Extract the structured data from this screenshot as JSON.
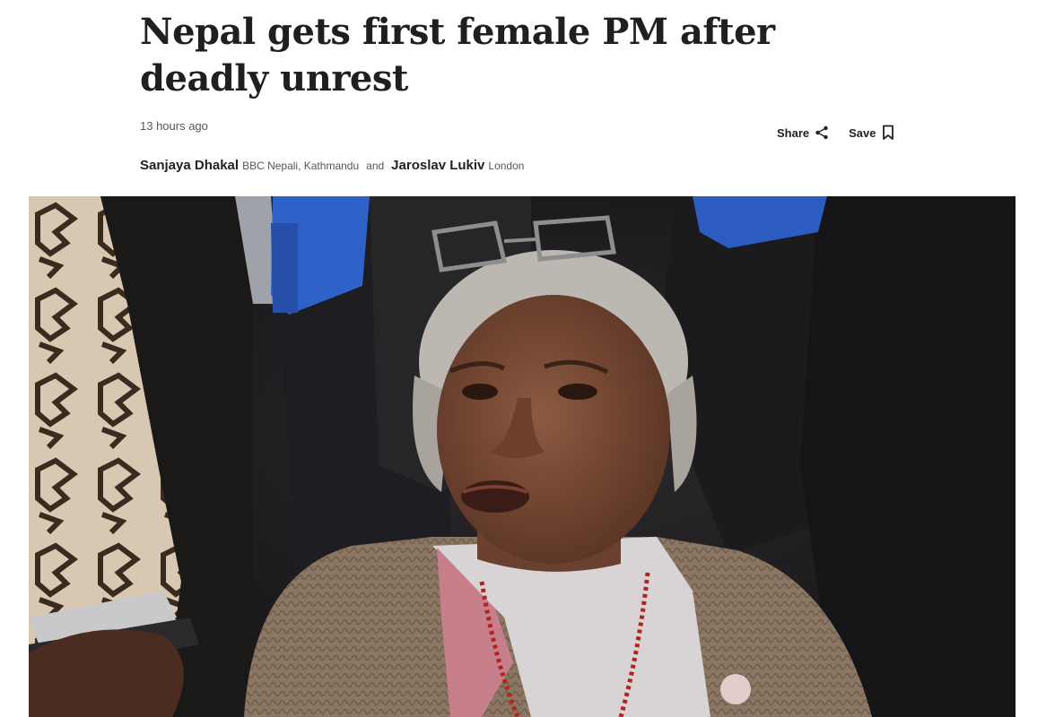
{
  "article": {
    "headline": "Nepal gets first female PM after deadly unrest",
    "timestamp": "13 hours ago",
    "share_label": "Share",
    "save_label": "Save",
    "authors": [
      {
        "name": "Sanjaya Dhakal",
        "affiliation": "BBC Nepali, Kathmandu"
      },
      {
        "name": "Jaroslav Lukiv",
        "affiliation": "London"
      }
    ],
    "author_joiner": "and"
  },
  "icons": {
    "share": "share-icon",
    "save": "bookmark-icon"
  }
}
